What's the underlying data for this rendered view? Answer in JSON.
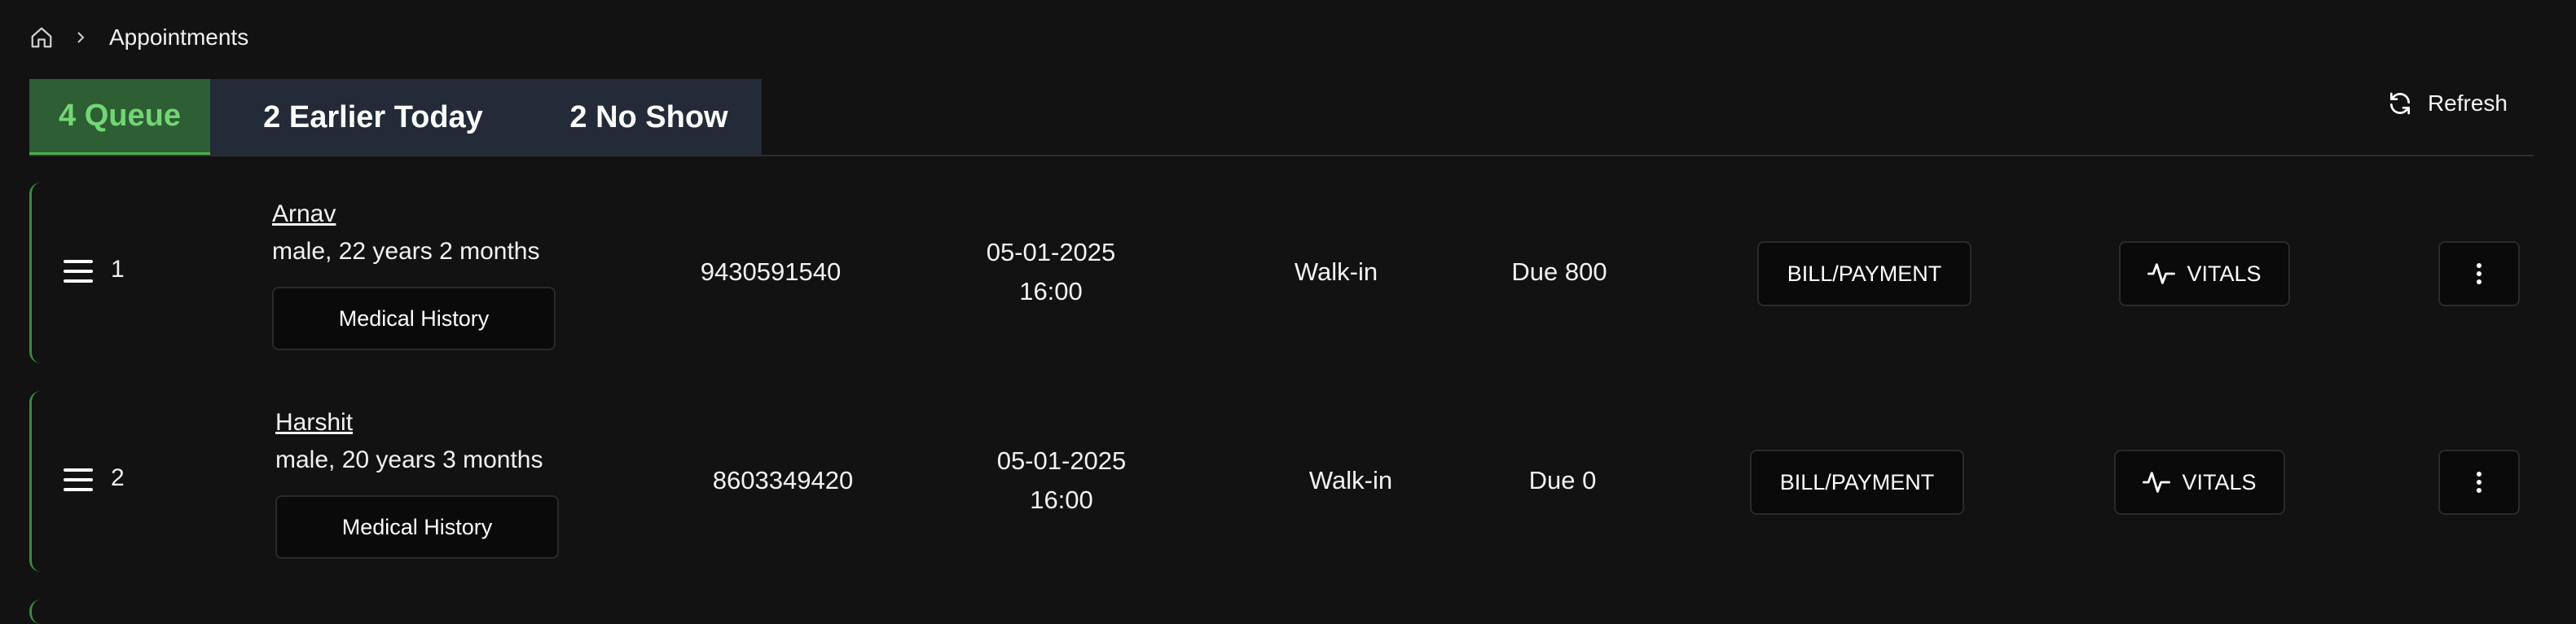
{
  "breadcrumb": {
    "home_icon": "home-icon",
    "separator_icon": "chevron-right-icon",
    "current": "Appointments"
  },
  "tabs": [
    {
      "label": "4 Queue",
      "active": true
    },
    {
      "label": "2 Earlier Today",
      "active": false
    },
    {
      "label": "2 No Show",
      "active": false
    }
  ],
  "refresh": {
    "label": "Refresh",
    "icon": "refresh-icon"
  },
  "rows": [
    {
      "serial": "1",
      "name": "Arnav",
      "details": "male, 22 years 2 months",
      "history_label": "Medical History",
      "phone": "9430591540",
      "date": "05-01-2025",
      "time": "16:00",
      "type": "Walk-in",
      "due": "Due 800",
      "bill_label": "BILL/PAYMENT",
      "vitals_label": "VITALS"
    },
    {
      "serial": "2",
      "name": "Harshit",
      "details": "male, 20 years 3 months",
      "history_label": "Medical History",
      "phone": "8603349420",
      "date": "05-01-2025",
      "time": "16:00",
      "type": "Walk-in",
      "due": "Due 0",
      "bill_label": "BILL/PAYMENT",
      "vitals_label": "VITALS"
    }
  ],
  "colors": {
    "accent": "#4caf50",
    "active_tab_bg": "#2e5e34",
    "active_tab_text": "#73d675",
    "inactive_tab_bg": "#222b37",
    "background": "#121212"
  }
}
